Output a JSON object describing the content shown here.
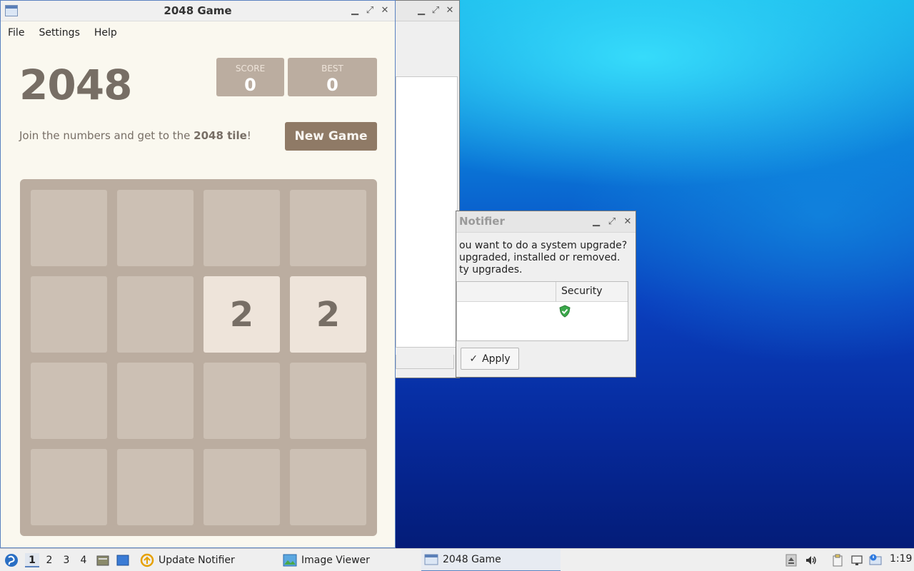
{
  "game_window": {
    "title": "2048 Game",
    "menu": [
      "File",
      "Settings",
      "Help"
    ],
    "game_title": "2048",
    "score_label": "SCORE",
    "score_value": "0",
    "best_label": "BEST",
    "best_value": "0",
    "intro_prefix": "Join the numbers and get to the ",
    "intro_bold": "2048 tile",
    "intro_suffix": "!",
    "new_game_label": "New Game",
    "tiles": [
      [
        "",
        "",
        "",
        ""
      ],
      [
        "",
        "",
        "2",
        "2"
      ],
      [
        "",
        "",
        "",
        ""
      ],
      [
        "",
        "",
        "",
        ""
      ]
    ],
    "tile_colors": {
      "empty": "#cdc1b4",
      "2": "#eee4da",
      "board": "#bbada0",
      "text": "#776e65"
    }
  },
  "notifier_dialog": {
    "title": "Notifier",
    "message_lines": [
      "ou want to do a system upgrade?",
      "upgraded, installed or removed.",
      "ty upgrades."
    ],
    "table_header": "Security",
    "apply_label": "Apply"
  },
  "taskbar": {
    "desktops": [
      "1",
      "2",
      "3",
      "4"
    ],
    "tasks": [
      {
        "label": "Update Notifier",
        "icon": "update-notifier-icon"
      },
      {
        "label": "Image Viewer",
        "icon": "image-viewer-icon"
      },
      {
        "label": "2048 Game",
        "icon": "window-icon"
      }
    ],
    "clock": "1:19"
  }
}
